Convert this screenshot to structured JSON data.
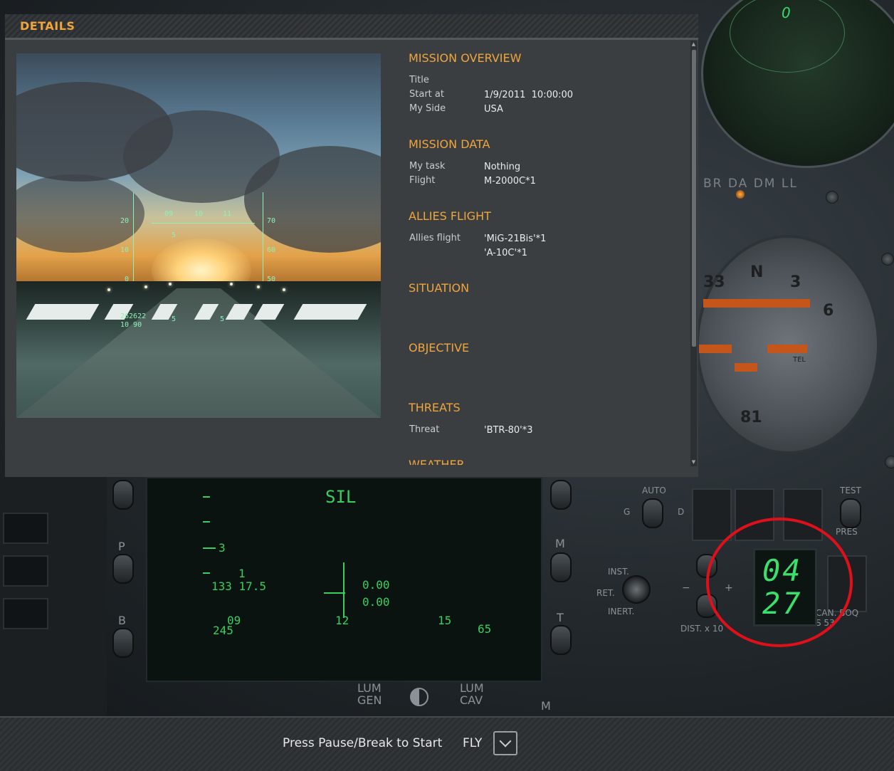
{
  "dialog": {
    "title": "DETAILS"
  },
  "mission_overview": {
    "heading": "MISSION OVERVIEW",
    "rows": [
      {
        "label": "Title",
        "value": ""
      },
      {
        "label": "Start at",
        "value": "1/9/2011  10:00:00"
      },
      {
        "label": "My Side",
        "value": "USA"
      }
    ]
  },
  "mission_data": {
    "heading": "MISSION DATA",
    "rows": [
      {
        "label": "My task",
        "value": "Nothing"
      },
      {
        "label": "Flight",
        "value": "M-2000C*1"
      }
    ]
  },
  "allies_flight": {
    "heading": "ALLIES FLIGHT",
    "label": "Allies flight",
    "values": [
      "'MiG-21Bis'*1",
      "'A-10C'*1"
    ]
  },
  "situation": {
    "heading": "SITUATION"
  },
  "objective": {
    "heading": "OBJECTIVE"
  },
  "threats": {
    "heading": "THREATS",
    "label": "Threat",
    "value": "'BTR-80'*3"
  },
  "weather": {
    "heading": "WEATHER"
  },
  "preview_hud": {
    "left_scale": [
      "20",
      "10",
      "0"
    ],
    "right_scale": [
      "70",
      "60",
      "50"
    ],
    "heading_marks": [
      "09",
      "10",
      "11"
    ],
    "small_5": "5",
    "readout1": "262622",
    "readout2": "10 90",
    "bottom_left": "5",
    "bottom_right": "5"
  },
  "cockpit": {
    "radar_value": "0",
    "lamp_labels": "BR DA DM LL",
    "hsi_n": "N",
    "hsi_3": "3",
    "hsi_33": "33",
    "hsi_6": "6",
    "hsi_81": "81",
    "hsi_tel": "TEL",
    "knob_labels": [
      "P",
      "B",
      "M",
      "T",
      "M"
    ],
    "vtb": {
      "mode": "SIL",
      "tick3": "3",
      "n1": "1",
      "n2": "133  17.5",
      "n3": "0.00",
      "n4": "0.00",
      "n5": "09",
      "n6": "12",
      "n7": "15",
      "n8": "245",
      "n9": "65"
    },
    "lum_gen": "LUM\nGEN",
    "lum_cav": "LUM\nCAV",
    "auto": "AUTO",
    "test": "TEST",
    "pres": "PRES",
    "g": "G",
    "d": "D",
    "inst": "INST.",
    "ret": "RET.",
    "inert": "INERT.",
    "dist": "DIST. x 10",
    "can_boq": "CAN. BOQ",
    "s53": "S 53",
    "minus": "−",
    "plus": "+",
    "digits_top": "04",
    "digits_bottom": "27"
  },
  "bottom_bar": {
    "press_text": "Press Pause/Break to Start",
    "fly_label": "FLY"
  },
  "colors": {
    "accent": "#f0a53c",
    "hud_green": "#36d05f",
    "annotation_red": "#e0101a"
  }
}
